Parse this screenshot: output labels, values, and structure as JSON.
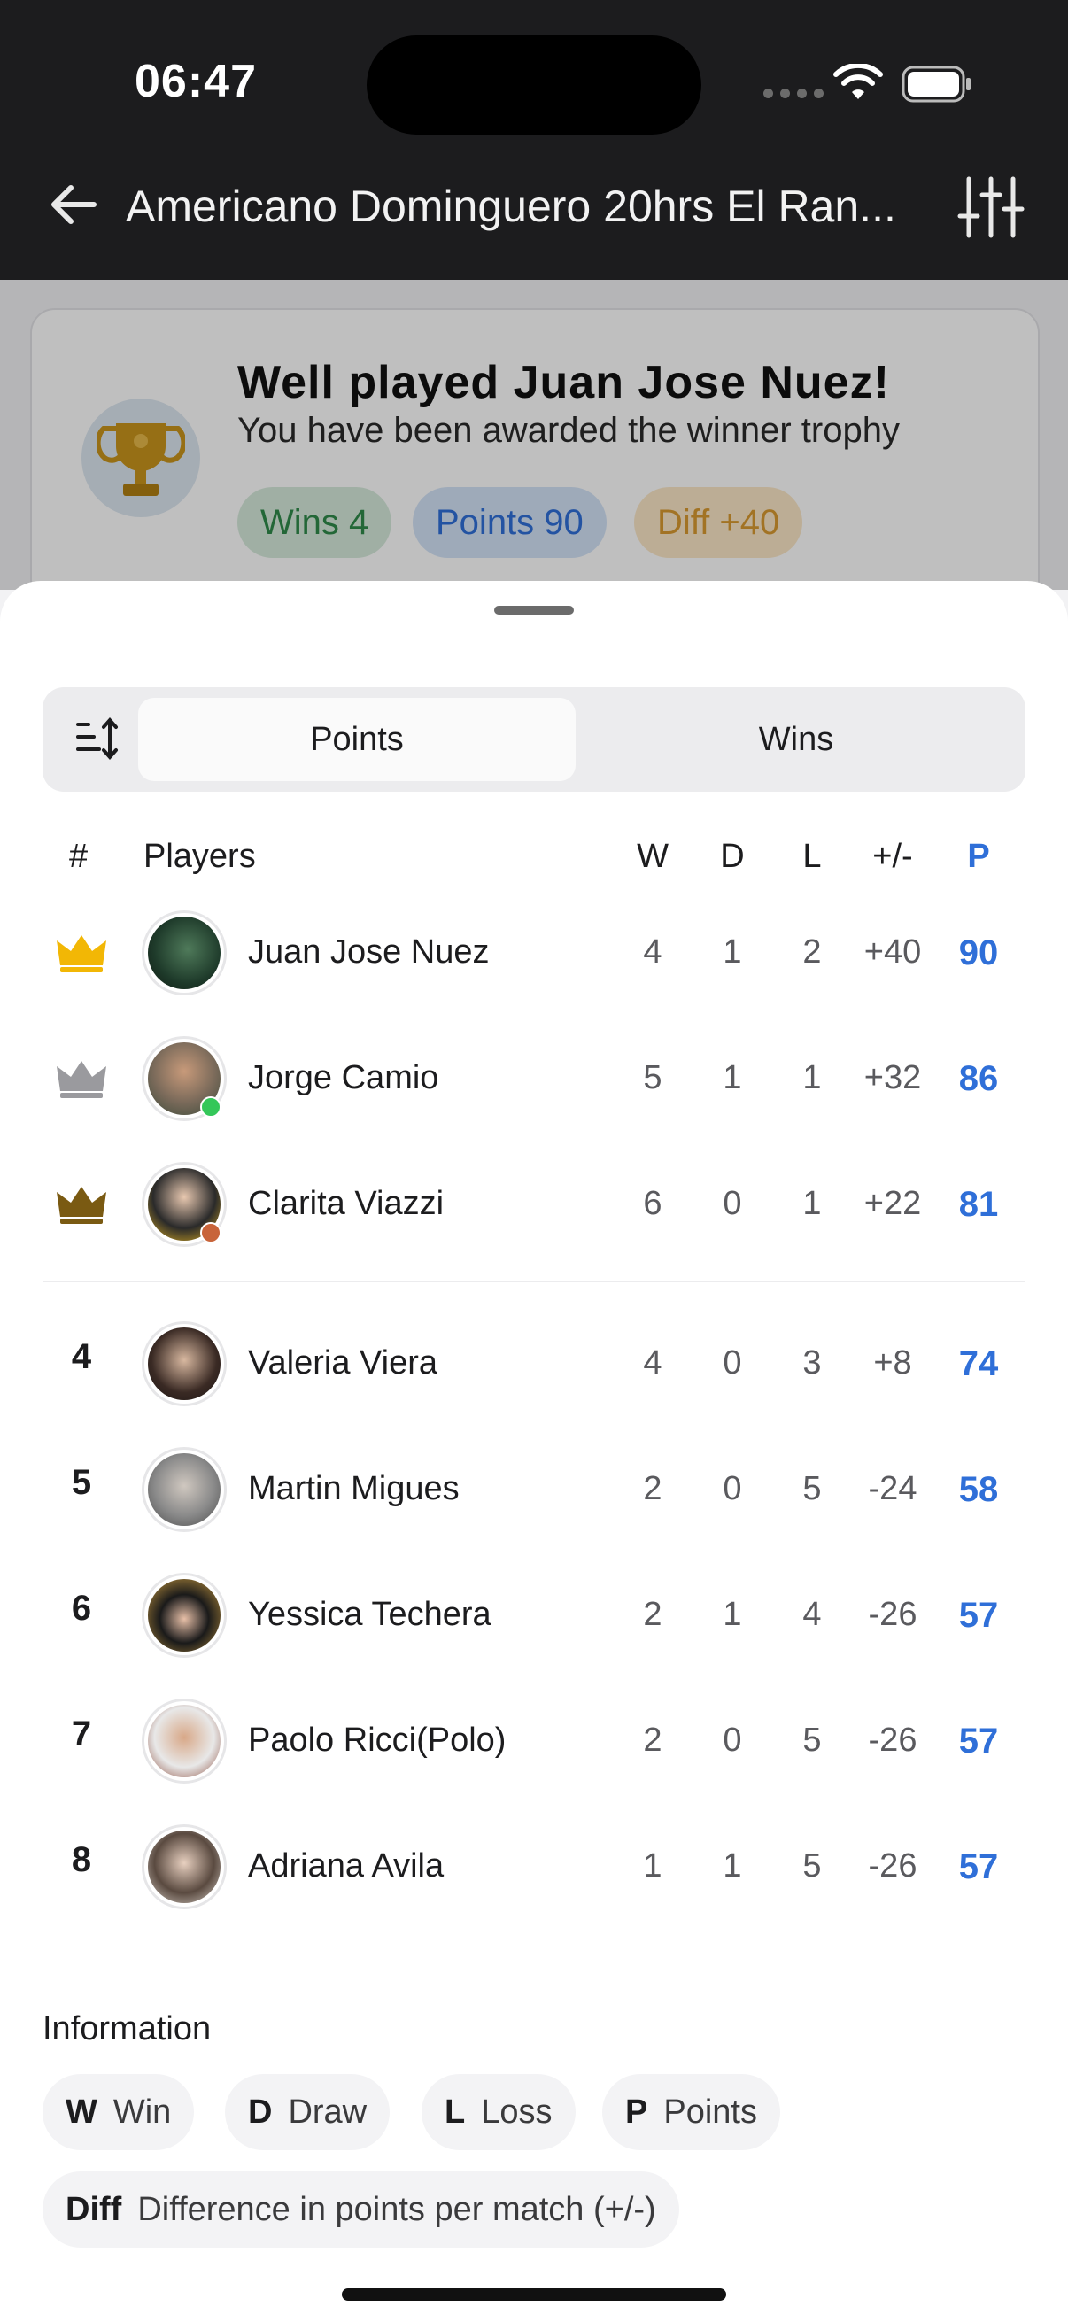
{
  "status_bar": {
    "time": "06:47"
  },
  "header": {
    "title": "Americano Dominguero 20hrs El Ran..."
  },
  "winner_card": {
    "title": "Well played Juan Jose Nuez!",
    "subtitle": "You have been awarded the winner trophy",
    "pills": {
      "wins": "Wins 4",
      "points": "Points 90",
      "diff": "Diff +40"
    }
  },
  "segmented": {
    "points_label": "Points",
    "wins_label": "Wins",
    "selected": "Points"
  },
  "table": {
    "headers": {
      "rank": "#",
      "players": "Players",
      "w": "W",
      "d": "D",
      "l": "L",
      "diff": "+/-",
      "p": "P"
    },
    "rows": [
      {
        "rank": "",
        "crown": "gold",
        "name": "Juan Jose Nuez",
        "w": "4",
        "d": "1",
        "l": "2",
        "diff": "+40",
        "p": "90"
      },
      {
        "rank": "",
        "crown": "silver",
        "name": "Jorge Camio",
        "w": "5",
        "d": "1",
        "l": "1",
        "diff": "+32",
        "p": "86"
      },
      {
        "rank": "",
        "crown": "bronze",
        "name": "Clarita Viazzi",
        "w": "6",
        "d": "0",
        "l": "1",
        "diff": "+22",
        "p": "81"
      },
      {
        "rank": "4",
        "name": "Valeria Viera",
        "w": "4",
        "d": "0",
        "l": "3",
        "diff": "+8",
        "p": "74"
      },
      {
        "rank": "5",
        "name": "Martin Migues",
        "w": "2",
        "d": "0",
        "l": "5",
        "diff": "-24",
        "p": "58"
      },
      {
        "rank": "6",
        "name": "Yessica Techera",
        "w": "2",
        "d": "1",
        "l": "4",
        "diff": "-26",
        "p": "57"
      },
      {
        "rank": "7",
        "name": "Paolo Ricci(Polo)",
        "w": "2",
        "d": "0",
        "l": "5",
        "diff": "-26",
        "p": "57"
      },
      {
        "rank": "8",
        "name": "Adriana Avila",
        "w": "1",
        "d": "1",
        "l": "5",
        "diff": "-26",
        "p": "57"
      }
    ]
  },
  "information": {
    "title": "Information",
    "chips": [
      {
        "key": "W",
        "label": "Win"
      },
      {
        "key": "D",
        "label": "Draw"
      },
      {
        "key": "L",
        "label": "Loss"
      },
      {
        "key": "P",
        "label": "Points"
      },
      {
        "key": "Diff",
        "label": "Difference in points per match (+/-)"
      }
    ]
  },
  "colors": {
    "accent_blue": "#2f6fd8",
    "gold": "#f2b705",
    "silver": "#9a9a9e",
    "bronze": "#7a5a12"
  }
}
